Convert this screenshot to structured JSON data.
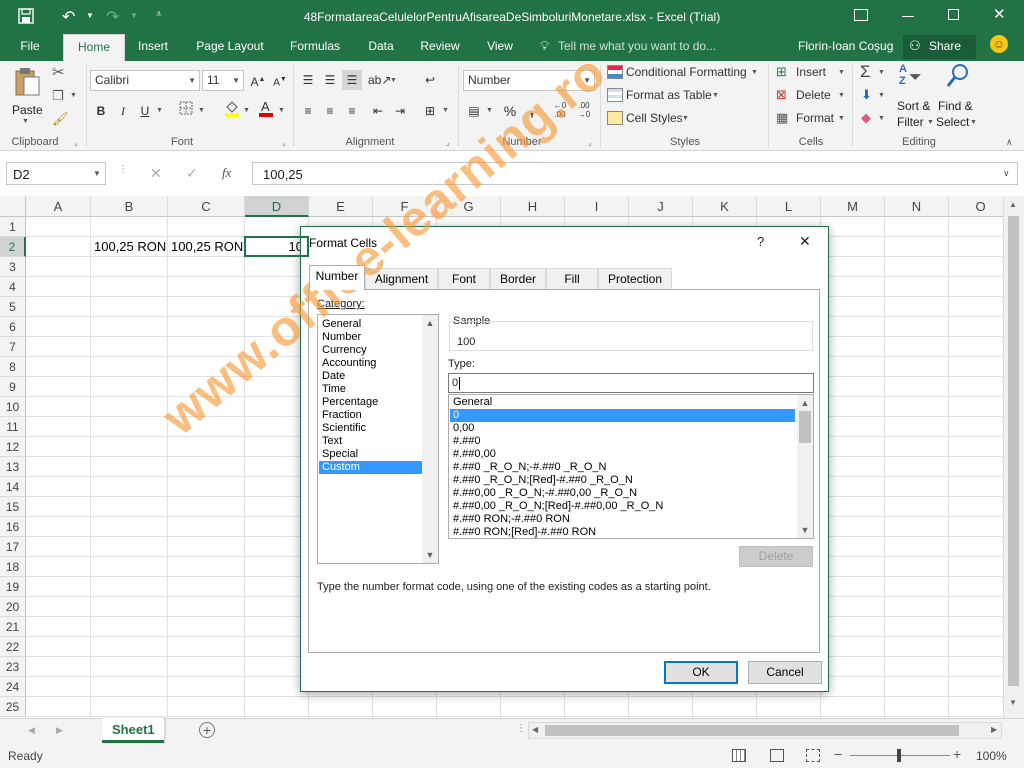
{
  "window": {
    "title": "48FormatareaCelulelorPentruAfisareaDeSimboluriMonetare.xlsx - Excel (Trial)"
  },
  "ribbon_tabs": [
    "File",
    "Home",
    "Insert",
    "Page Layout",
    "Formulas",
    "Data",
    "Review",
    "View"
  ],
  "active_tab": "Home",
  "tell_me": "Tell me what you want to do...",
  "user_name": "Florin-Ioan Coşug",
  "share_label": "Share",
  "ribbon": {
    "clipboard": {
      "paste": "Paste",
      "label": "Clipboard"
    },
    "font": {
      "name": "Calibri",
      "size": "11",
      "bold": "B",
      "italic": "I",
      "underline": "U",
      "label": "Font"
    },
    "alignment": {
      "label": "Alignment"
    },
    "number": {
      "format": "Number",
      "label": "Number",
      "percent": "%"
    },
    "styles": {
      "conditional": "Conditional Formatting",
      "format_table": "Format as Table",
      "cell_styles": "Cell Styles",
      "label": "Styles"
    },
    "cells": {
      "insert": "Insert",
      "delete": "Delete",
      "format": "Format",
      "label": "Cells"
    },
    "editing": {
      "sort": "Sort &",
      "filter": "Filter",
      "find": "Find &",
      "select": "Select",
      "label": "Editing"
    }
  },
  "formula_bar": {
    "name_box": "D2",
    "fx": "fx",
    "value": "100,25"
  },
  "columns": [
    "A",
    "B",
    "C",
    "D",
    "E",
    "F",
    "G",
    "H",
    "I",
    "J",
    "K",
    "L",
    "M",
    "N",
    "O"
  ],
  "rows": [
    "1",
    "2",
    "3",
    "4",
    "5",
    "6",
    "7",
    "8",
    "9",
    "10",
    "11",
    "12",
    "13",
    "14",
    "15",
    "16",
    "17",
    "18",
    "19",
    "20",
    "21",
    "22",
    "23",
    "24",
    "25"
  ],
  "cells": {
    "B2": "100,25 RON",
    "C2": "100,25 RON",
    "D2": "10"
  },
  "sheet_tab": "Sheet1",
  "status": {
    "ready": "Ready",
    "zoom": "100%"
  },
  "dialog": {
    "title": "Format Cells",
    "help": "?",
    "tabs": [
      "Number",
      "Alignment",
      "Font",
      "Border",
      "Fill",
      "Protection"
    ],
    "category_label": "Category:",
    "categories": [
      "General",
      "Number",
      "Currency",
      "Accounting",
      "Date",
      "Time",
      "Percentage",
      "Fraction",
      "Scientific",
      "Text",
      "Special",
      "Custom"
    ],
    "selected_category": "Custom",
    "sample_label": "Sample",
    "sample_value": "100",
    "type_label": "Type:",
    "type_value": "0",
    "formats": [
      "General",
      "0",
      "0,00",
      "#.##0",
      "#.##0,00",
      "#.##0 _R_O_N;-#.##0 _R_O_N",
      "#.##0 _R_O_N;[Red]-#.##0 _R_O_N",
      "#.##0,00 _R_O_N;-#.##0,00 _R_O_N",
      "#.##0,00 _R_O_N;[Red]-#.##0,00 _R_O_N",
      "#.##0 RON;-#.##0 RON",
      "#.##0 RON;[Red]-#.##0 RON"
    ],
    "selected_format": "0",
    "delete_label": "Delete",
    "hint": "Type the number format code, using one of the existing codes as a starting point.",
    "ok_label": "OK",
    "cancel_label": "Cancel"
  },
  "watermark": "www.office-learning.ro",
  "colors": {
    "excel_green": "#217346",
    "selection_blue": "#3399ff",
    "watermark": "#f69632"
  }
}
